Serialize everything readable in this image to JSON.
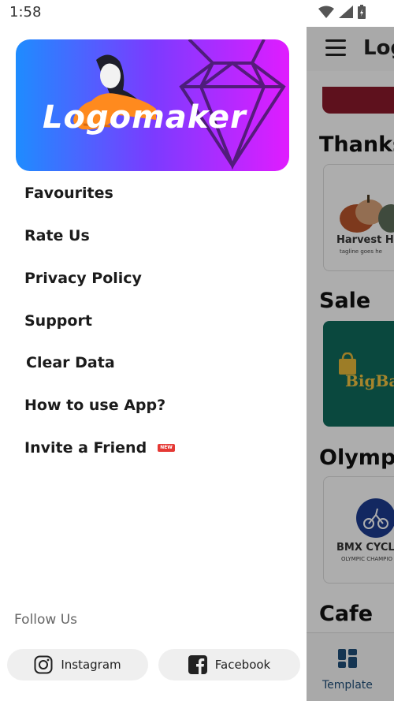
{
  "status_bar": {
    "time": "1:58"
  },
  "drawer": {
    "hero_text": "Logomaker",
    "menu": [
      {
        "label": "Favourites"
      },
      {
        "label": "Rate Us"
      },
      {
        "label": "Privacy Policy"
      },
      {
        "label": "Support"
      },
      {
        "label": "Clear Data"
      },
      {
        "label": "How to use App?"
      },
      {
        "label": "Invite a Friend",
        "badge": "NEW"
      }
    ],
    "follow_label": "Follow Us",
    "social": {
      "instagram": "Instagram",
      "facebook": "Facebook"
    }
  },
  "background_app": {
    "title": "Log",
    "sections": [
      "Thanks",
      "Sale",
      "Olympi",
      "Cafe"
    ],
    "cards": {
      "harvest_title": "Harvest He",
      "harvest_sub": "tagline goes he",
      "bigbaz": "BigBaz",
      "bmx_title": "BMX CYCL",
      "bmx_sub": "OLYMPIC CHAMPIO"
    },
    "bottom_nav_label": "Template"
  },
  "colors": {
    "hero_gradient_start": "#1e8cff",
    "hero_gradient_end": "#e01cff",
    "badge": "#e53935",
    "nav_accent": "#1f4e7a"
  }
}
